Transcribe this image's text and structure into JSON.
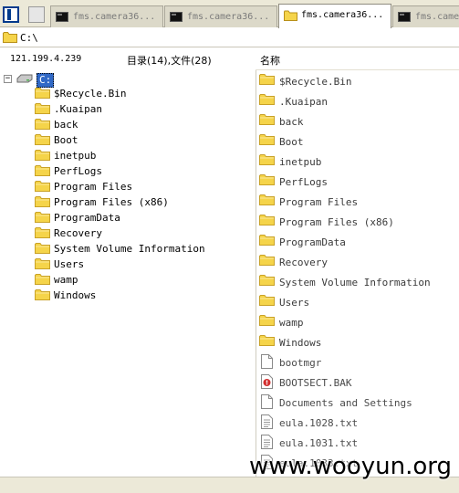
{
  "tabs": [
    {
      "label": "fms.camera36...",
      "active": false
    },
    {
      "label": "fms.camera36...",
      "active": false
    },
    {
      "label": "fms.camera36...",
      "active": true
    },
    {
      "label": "fms.camer",
      "active": false
    }
  ],
  "address": {
    "path": "C:\\"
  },
  "info": {
    "host": "121.199.4.239",
    "summary": "目录(14),文件(28)"
  },
  "list_header": {
    "name_column": "名称"
  },
  "tree": {
    "root_label": "C:",
    "items": [
      "$Recycle.Bin",
      ".Kuaipan",
      "back",
      "Boot",
      "inetpub",
      "PerfLogs",
      "Program Files",
      "Program Files (x86)",
      "ProgramData",
      "Recovery",
      "System Volume Information",
      "Users",
      "wamp",
      "Windows"
    ]
  },
  "files": [
    {
      "name": "$Recycle.Bin",
      "type": "folder"
    },
    {
      "name": ".Kuaipan",
      "type": "folder"
    },
    {
      "name": "back",
      "type": "folder"
    },
    {
      "name": "Boot",
      "type": "folder"
    },
    {
      "name": "inetpub",
      "type": "folder"
    },
    {
      "name": "PerfLogs",
      "type": "folder"
    },
    {
      "name": "Program Files",
      "type": "folder"
    },
    {
      "name": "Program Files (x86)",
      "type": "folder"
    },
    {
      "name": "ProgramData",
      "type": "folder"
    },
    {
      "name": "Recovery",
      "type": "folder"
    },
    {
      "name": "System Volume Information",
      "type": "folder"
    },
    {
      "name": "Users",
      "type": "folder"
    },
    {
      "name": "wamp",
      "type": "folder"
    },
    {
      "name": "Windows",
      "type": "folder"
    },
    {
      "name": "bootmgr",
      "type": "file"
    },
    {
      "name": "BOOTSECT.BAK",
      "type": "bak"
    },
    {
      "name": "Documents and Settings",
      "type": "file"
    },
    {
      "name": "eula.1028.txt",
      "type": "text"
    },
    {
      "name": "eula.1031.txt",
      "type": "text"
    },
    {
      "name": "eula.1033.txt",
      "type": "text"
    }
  ],
  "watermark": "www.wooyun.org",
  "colors": {
    "folder": "#f5d44a",
    "folder_edge": "#c9a227",
    "selection": "#3169c6"
  }
}
